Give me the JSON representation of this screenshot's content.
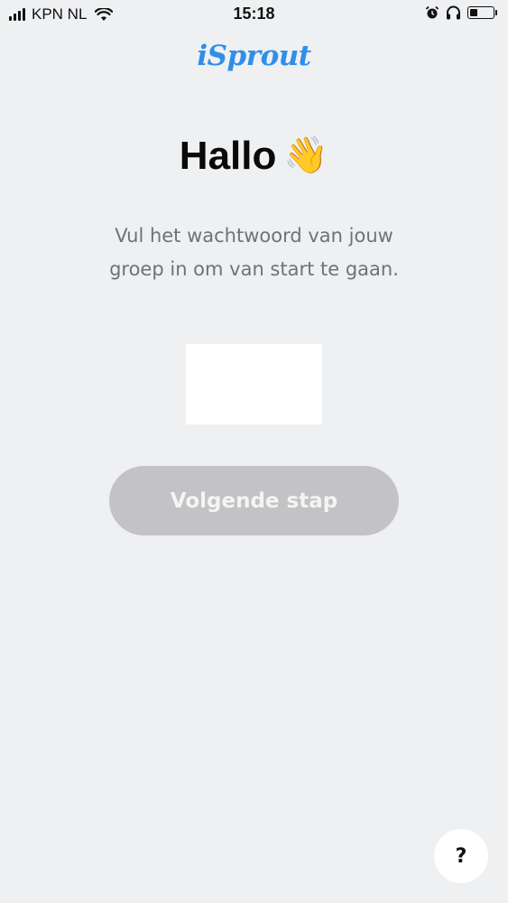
{
  "status_bar": {
    "carrier": "KPN NL",
    "time": "15:18",
    "battery_level": 0.35,
    "icons": [
      "signal-icon",
      "wifi-icon",
      "alarm-icon",
      "headphones-icon",
      "battery-icon"
    ]
  },
  "app": {
    "logo_text": "iSprout",
    "brand_color": "#2f8fe8"
  },
  "main": {
    "greeting": "Hallo",
    "greeting_emoji": "👋",
    "instruction_line1": "Vul het wachtwoord van jouw",
    "instruction_line2": "groep in om van start te gaan.",
    "password_value": "",
    "next_button_label": "Volgende stap",
    "help_label": "?"
  }
}
